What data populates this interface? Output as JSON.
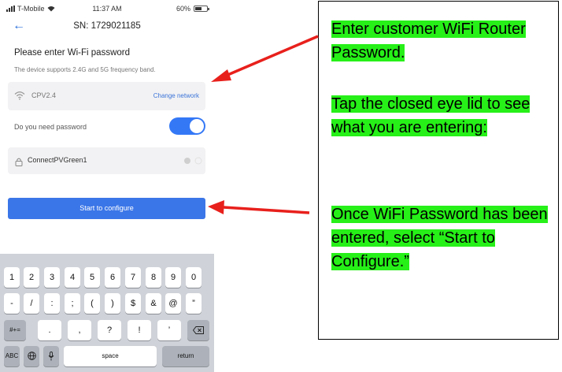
{
  "status_bar": {
    "carrier": "T-Mobile",
    "time": "11:37 AM",
    "battery": "60%",
    "battery_level": 0.6
  },
  "nav": {
    "back_icon": "back-arrow-icon",
    "title": "SN: 1729021185"
  },
  "form": {
    "heading": "Please enter Wi-Fi password",
    "subtext": "The device supports 2.4G and 5G frequency band.",
    "network_name": "CPV2.4",
    "change_network_label": "Change network",
    "need_password_label": "Do you need password",
    "need_password_on": true,
    "password_value": "ConnectPVGreen1",
    "configure_button_label": "Start to configure"
  },
  "keyboard": {
    "row1": [
      "1",
      "2",
      "3",
      "4",
      "5",
      "6",
      "7",
      "8",
      "9",
      "0"
    ],
    "row2": [
      "-",
      "/",
      ":",
      ";",
      "(",
      ")",
      "$",
      "&",
      "@",
      "”"
    ],
    "row3_left": "#+=",
    "row3": [
      ".",
      ",",
      "?",
      "!",
      "’"
    ],
    "row3_right_icon": "backspace-icon",
    "row4": {
      "abc": "ABC",
      "globe_icon": "globe-icon",
      "mic_icon": "microphone-icon",
      "space": "space",
      "return": "return"
    }
  },
  "callout": {
    "step1": "Enter customer WiFi Router Password.",
    "step2": "Tap the closed eye lid to see what you are entering:",
    "step3": "Once WiFi Password has been entered, select “Start to Configure.”"
  },
  "colors": {
    "highlight": "#26f018",
    "arrow": "#e8201c",
    "accent": "#3478f6"
  }
}
